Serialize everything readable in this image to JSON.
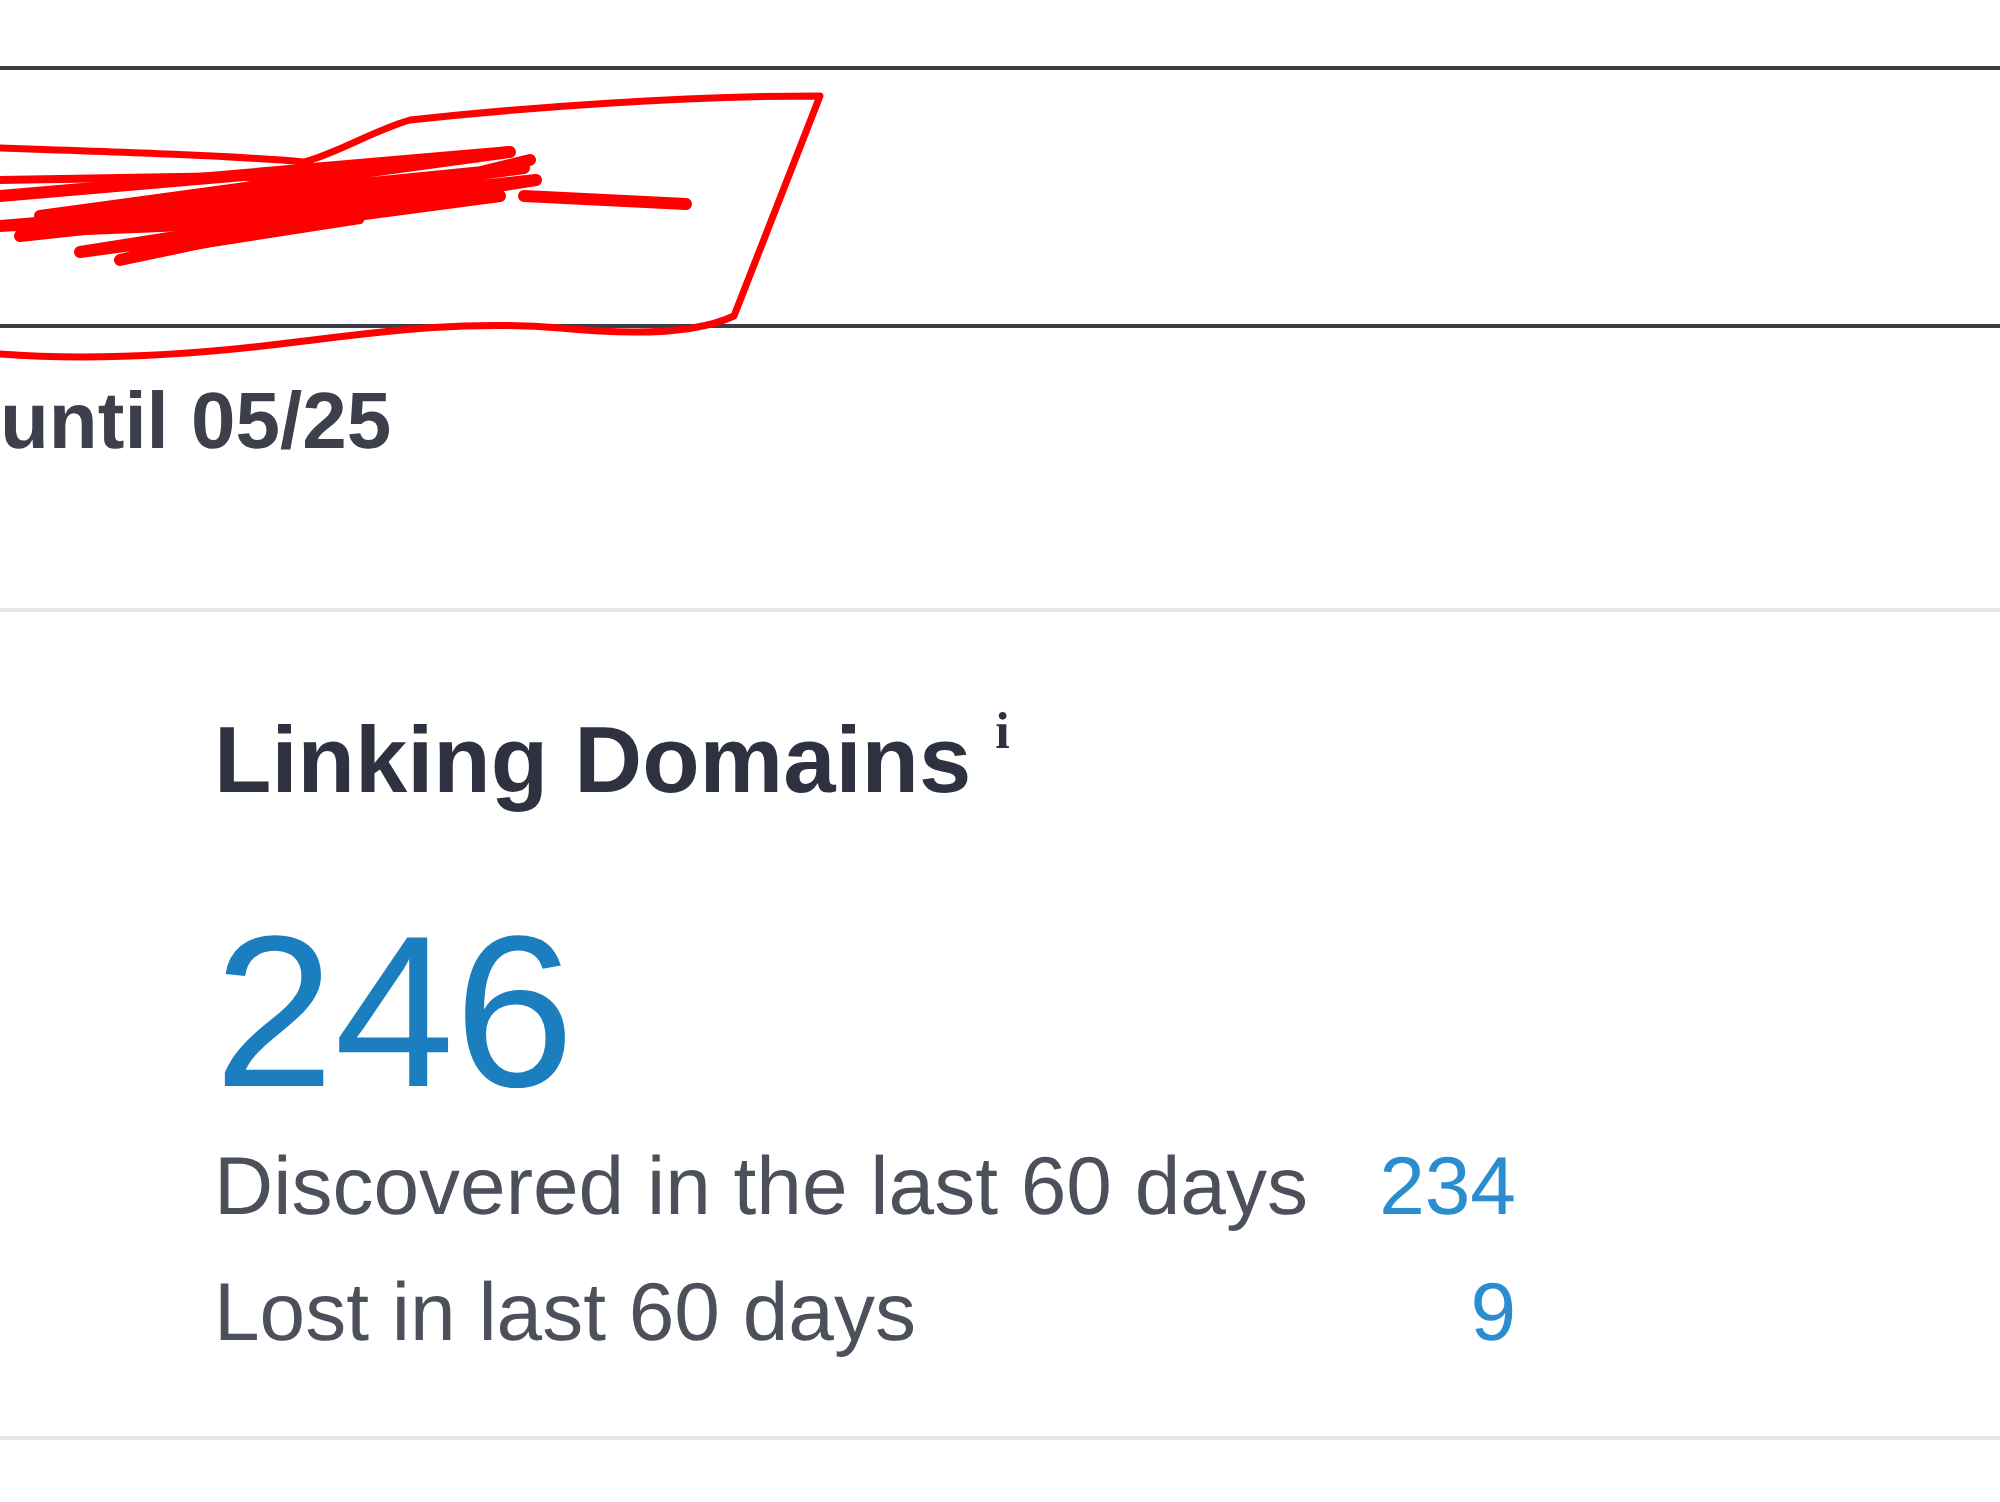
{
  "input_field": {
    "redacted": true
  },
  "subscription_note": "until 05/25",
  "metric_card": {
    "title": "Linking Domains",
    "info_marker": "i",
    "value": "246",
    "stats": [
      {
        "label": "Discovered in the last 60 days",
        "value": "234"
      },
      {
        "label": "Lost in last 60 days",
        "value": "9"
      }
    ]
  }
}
